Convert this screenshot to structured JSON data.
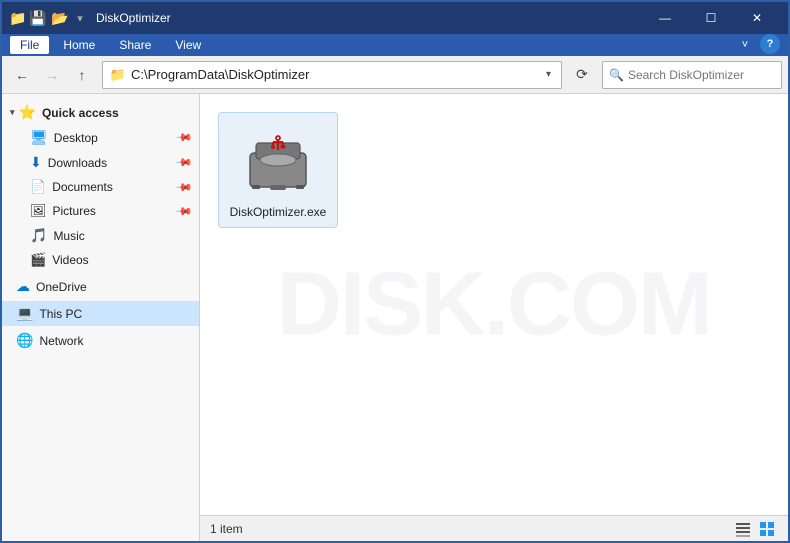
{
  "window": {
    "title": "DiskOptimizer",
    "titlebar_icons": [
      "folder-icon",
      "save-icon",
      "folder2-icon"
    ],
    "controls": {
      "minimize": "—",
      "maximize": "☐",
      "close": "✕"
    }
  },
  "menu": {
    "items": [
      {
        "label": "File",
        "active": true
      },
      {
        "label": "Home",
        "active": false
      },
      {
        "label": "Share",
        "active": false
      },
      {
        "label": "View",
        "active": false
      }
    ],
    "chevron": "˅",
    "help": "?"
  },
  "nav": {
    "back_title": "←",
    "forward_title": "→",
    "up_title": "↑",
    "address": "C:\\ProgramData\\DiskOptimizer",
    "address_icon": "📁",
    "refresh": "⟳",
    "search_placeholder": "Search DiskOptimizer"
  },
  "sidebar": {
    "quick_access": {
      "label": "Quick access",
      "icon": "⭐",
      "items": [
        {
          "label": "Desktop",
          "icon": "🖥",
          "pinned": true,
          "pin_color": "gray"
        },
        {
          "label": "Downloads",
          "icon": "⬇",
          "pinned": true,
          "pin_color": "blue"
        },
        {
          "label": "Documents",
          "icon": "📄",
          "pinned": true,
          "pin_color": "gray"
        },
        {
          "label": "Pictures",
          "icon": "🖼",
          "pinned": true,
          "pin_color": "gray"
        },
        {
          "label": "Music",
          "icon": "🎵",
          "pinned": false
        },
        {
          "label": "Videos",
          "icon": "🎬",
          "pinned": false
        }
      ]
    },
    "onedrive": {
      "label": "OneDrive",
      "icon": "☁"
    },
    "this_pc": {
      "label": "This PC",
      "icon": "💻",
      "active": true
    },
    "network": {
      "label": "Network",
      "icon": "🌐"
    }
  },
  "files": [
    {
      "name": "DiskOptimizer.exe",
      "type": "exe"
    }
  ],
  "status": {
    "item_count": "1 item"
  },
  "watermark": "DISK.COM"
}
